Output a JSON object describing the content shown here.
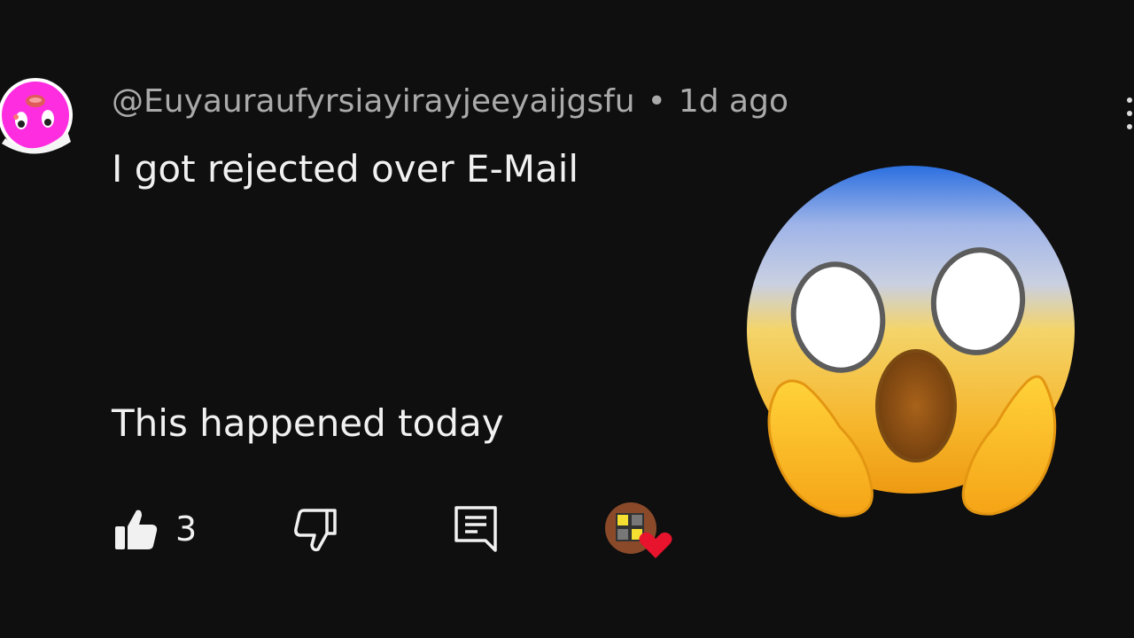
{
  "comment": {
    "username": "@Euyauraufyrsiayirayjeeyaijgsfu",
    "separator": "•",
    "time": "1d ago",
    "text_line1": "I got rejected over E-Mail",
    "text_line2": "This happened today"
  },
  "actions": {
    "like_count": "3"
  },
  "icons": {
    "avatar": "pink-character-avatar",
    "like": "thumbs-up-icon",
    "dislike": "thumbs-down-icon",
    "reply": "reply-icon",
    "creator_heart": "creator-heart-badge",
    "more": "more-vertical-icon",
    "emoji": "face-screaming-in-fear-emoji"
  },
  "colors": {
    "background": "#0f0f0f",
    "meta_text": "#aaaaaa",
    "primary_text": "#f1f1f1",
    "heart": "#e8132c",
    "avatar_pink": "#ff2de0"
  }
}
